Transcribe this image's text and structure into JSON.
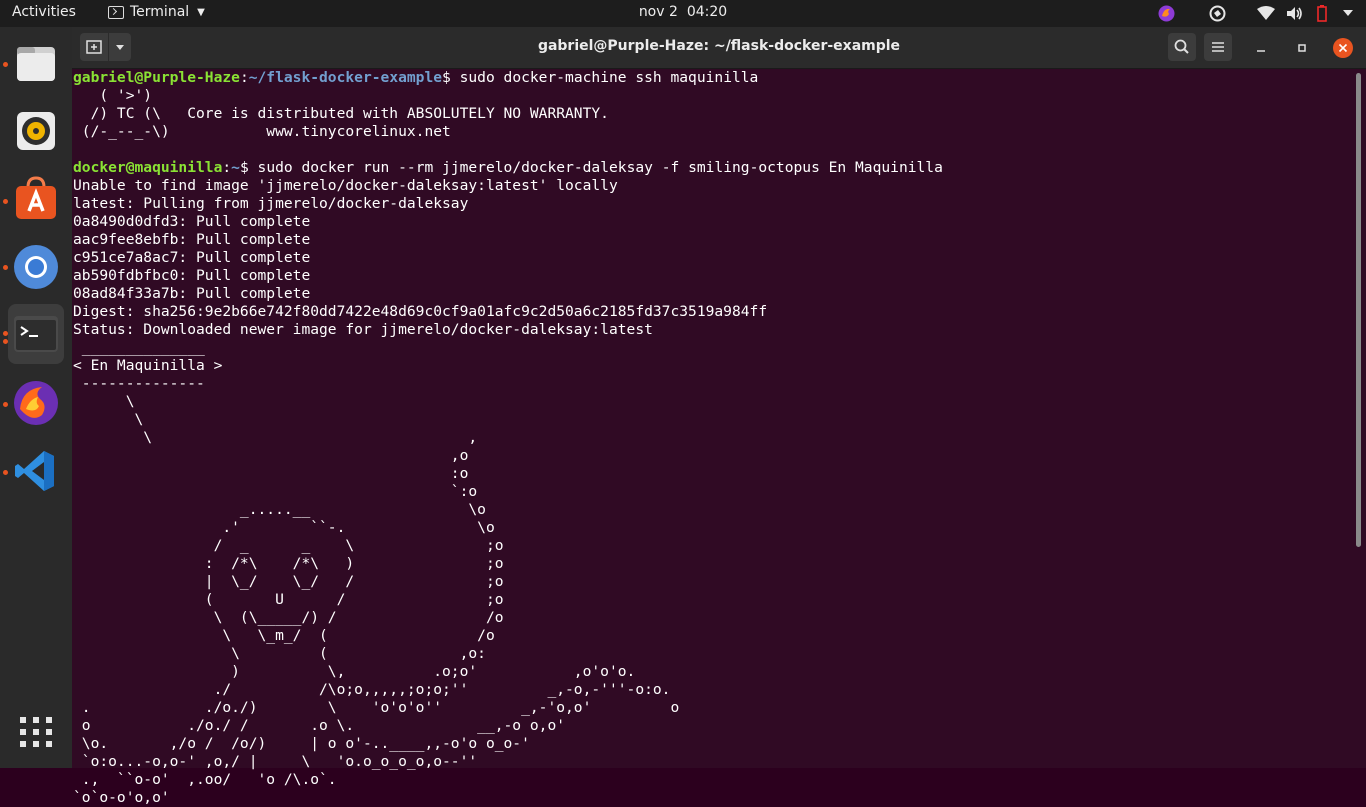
{
  "topbar": {
    "activities": "Activities",
    "app_name": "Terminal",
    "date": "nov 2",
    "time": "04:20"
  },
  "dock": {
    "items": [
      {
        "name": "files",
        "icon": "folder-icon"
      },
      {
        "name": "rhythmbox",
        "icon": "speaker-icon"
      },
      {
        "name": "software",
        "icon": "shopping-bag-icon"
      },
      {
        "name": "chromium",
        "icon": "chromium-icon"
      },
      {
        "name": "terminal",
        "icon": "terminal-icon"
      },
      {
        "name": "firefox-nightly",
        "icon": "firefox-icon"
      },
      {
        "name": "vscode",
        "icon": "vscode-icon"
      }
    ],
    "apps_grid": "show-applications-icon"
  },
  "window": {
    "title": "gabriel@Purple-Haze: ~/flask-docker-example"
  },
  "colors": {
    "terminal_bg": "#300a24",
    "prompt_user": "#8ae234",
    "prompt_path": "#729fcf",
    "accent": "#e95420"
  },
  "terminal": {
    "prompt1": {
      "user": "gabriel@Purple-Haze",
      "sep": ":",
      "path": "~/flask-docker-example",
      "symbol": "$ ",
      "command": "sudo docker-machine ssh maquinilla"
    },
    "banner": "   ( '>')\n  /) TC (\\   Core is distributed with ABSOLUTELY NO WARRANTY.\n (/-_--_-\\)           www.tinycorelinux.net\n",
    "prompt2": {
      "user": "docker@maquinilla",
      "sep": ":",
      "path": "~",
      "symbol": "$ ",
      "command": "sudo docker run --rm jjmerelo/docker-daleksay -f smiling-octopus En Maquinilla"
    },
    "output": "Unable to find image 'jjmerelo/docker-daleksay:latest' locally\nlatest: Pulling from jjmerelo/docker-daleksay\n0a8490d0dfd3: Pull complete\naac9fee8ebfb: Pull complete\nc951ce7a8ac7: Pull complete\nab590fdbfbc0: Pull complete\n08ad84f33a7b: Pull complete\nDigest: sha256:9e2b66e742f80dd7422e48d69c0cf9a01afc9c2d50a6c2185fd37c3519a984ff\nStatus: Downloaded newer image for jjmerelo/docker-daleksay:latest\n ______________\n< En Maquinilla >\n --------------\n      \\\n       \\\n        \\                                    ,\n                                           ,o\n                                           :o\n                                           `:o\n                   _.....__                  \\o\n                 .'        ``-.               \\o\n                /  _      _    \\               ;o\n               :  /*\\    /*\\   )               ;o\n               |  \\_/    \\_/   /               ;o\n               (       U      /                ;o\n                \\  (\\_____/) /                 /o\n                 \\   \\_m_/  (                 /o\n                  \\         (               ,o:\n                  )          \\,          .o;o'           ,o'o'o.\n                ./          /\\o;o,,,,,;o;o;''         _,-o,-'''-o:o.\n .             ./o./)        \\    'o'o'o''         _,-'o,o'         o\n o           ./o./ /       .o \\.              __,-o o,o'\n \\o.       ,/o /  /o/)     | o o'-..____,,-o'o o_o-'\n `o:o...-o,o-' ,o,/ |     \\   'o.o_o_o_o,o--''\n .,  ``o-o'  ,.oo/   'o /\\.o`.\n`o`o-o'o,o'"
  }
}
